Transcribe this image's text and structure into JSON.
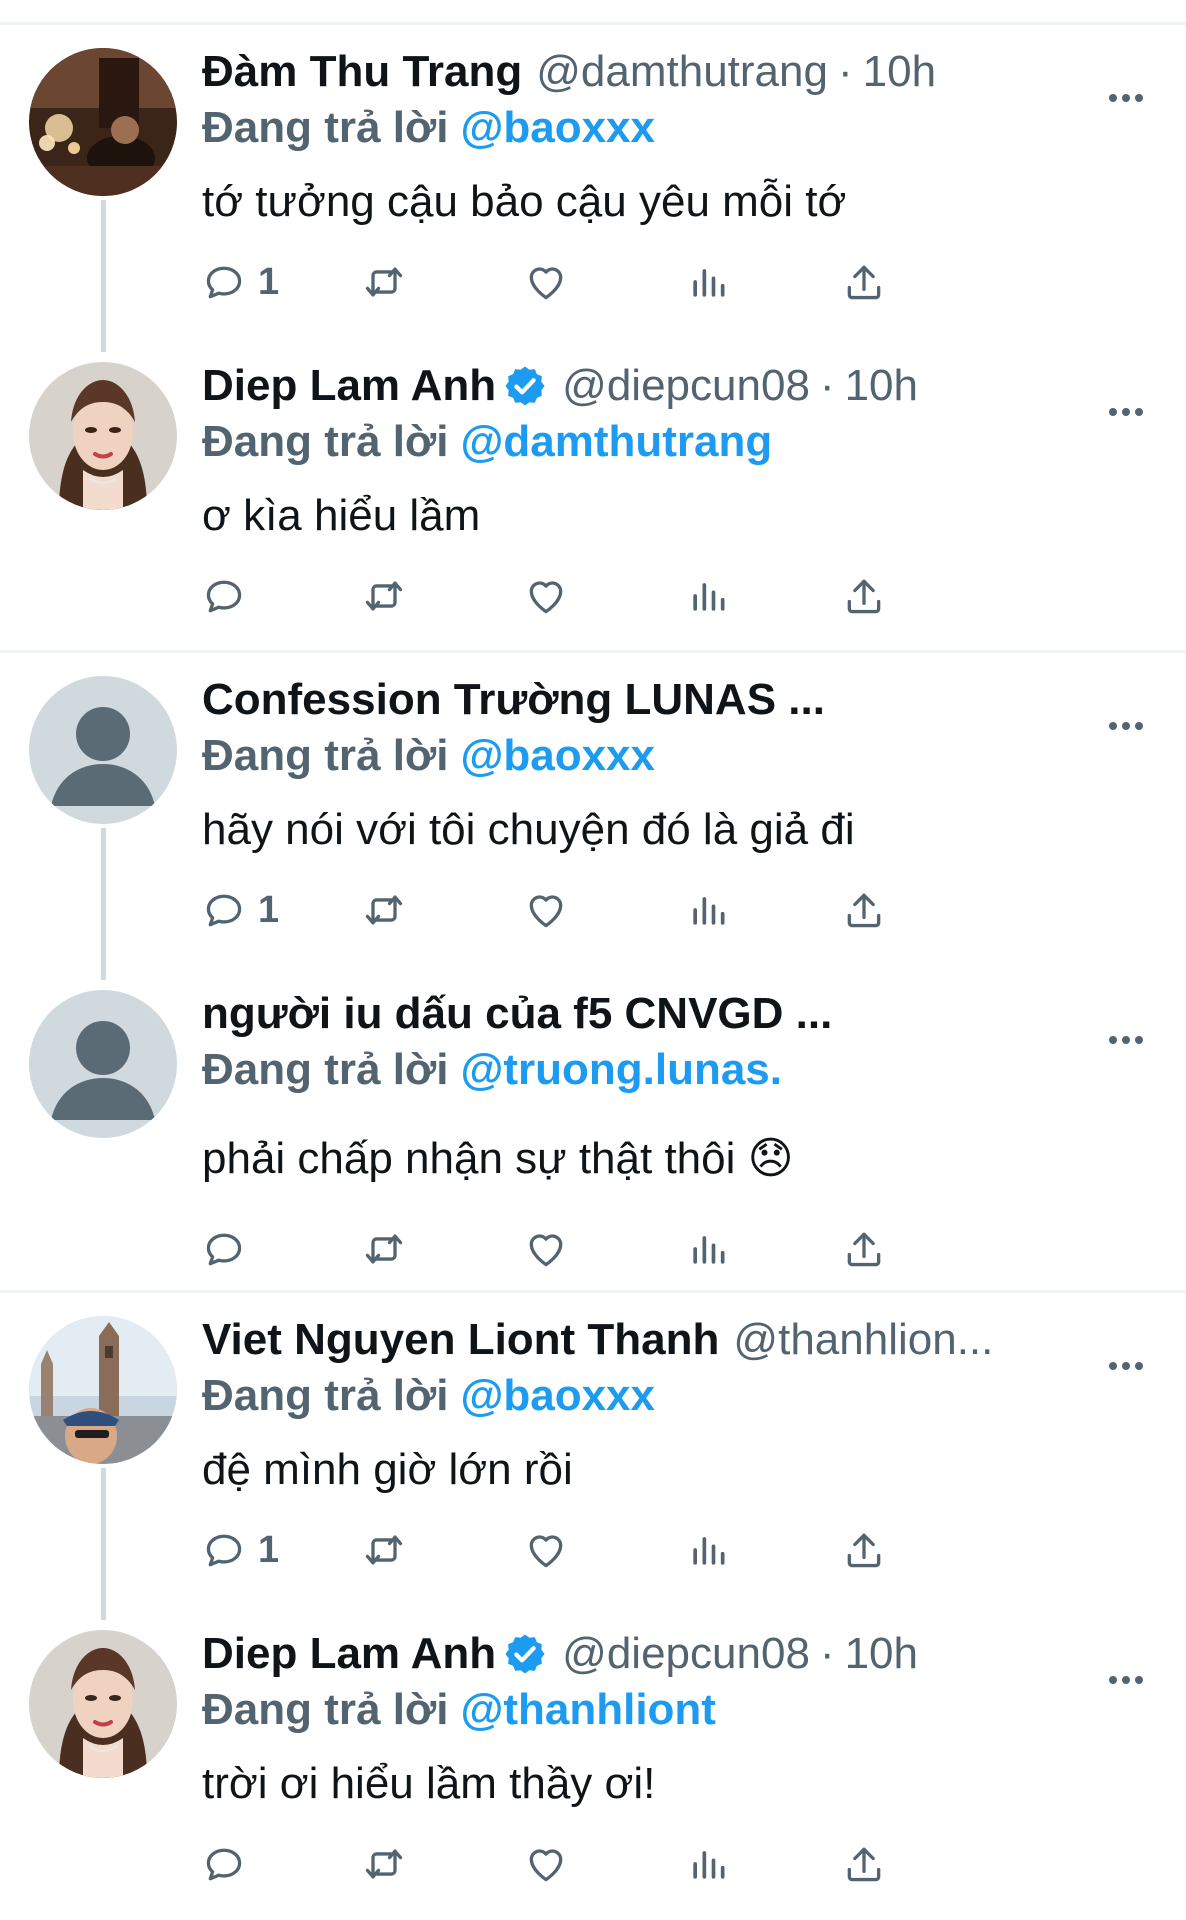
{
  "reply_prefix": "Đang trả lời",
  "tweets": [
    {
      "name": "Đàm Thu Trang",
      "verified": false,
      "handle": "@damthutrang",
      "separator": "·",
      "time": "10h",
      "reply_to": "@baoxxx",
      "text": "tớ tưởng cậu bảo cậu yêu mỗi tớ",
      "reply_count": "1",
      "avatar": "photo-candlelit-room"
    },
    {
      "name": "Diep Lam Anh",
      "verified": true,
      "handle": "@diepcun08",
      "separator": "·",
      "time": "10h",
      "reply_to": "@damthutrang",
      "text": "ơ kìa hiểu lầm",
      "reply_count": "",
      "avatar": "photo-woman-portrait"
    },
    {
      "name": "Confession Trường LUNAS ...",
      "verified": false,
      "handle": "",
      "separator": "",
      "time": "",
      "reply_to": "@baoxxx",
      "text": "hãy nói với tôi chuyện đó là giả đi",
      "reply_count": "1",
      "avatar": "default-profile"
    },
    {
      "name": "người iu dấu của f5 CNVGD ...",
      "verified": false,
      "handle": "",
      "separator": "",
      "time": "",
      "reply_to": "@truong.lunas.",
      "text": "phải chấp nhận sự thật thôi 😞",
      "reply_count": "",
      "avatar": "default-profile"
    },
    {
      "name": "Viet Nguyen Liont Thanh",
      "verified": false,
      "handle": "@thanhlion...",
      "separator": "",
      "time": "",
      "reply_to": "@baoxxx",
      "text": "đệ mình giờ lớn rồi",
      "reply_count": "1",
      "avatar": "photo-man-with-cap"
    },
    {
      "name": "Diep Lam Anh",
      "verified": true,
      "handle": "@diepcun08",
      "separator": "·",
      "time": "10h",
      "reply_to": "@thanhliont",
      "text": "trời ơi hiểu lầm thầy ơi!",
      "reply_count": "",
      "avatar": "photo-woman-portrait"
    }
  ],
  "icons": {
    "reply": "reply-icon",
    "retweet": "retweet-icon",
    "like": "heart-icon",
    "views": "views-icon",
    "share": "share-icon",
    "more": "more-icon",
    "verified": "verified-badge-icon"
  },
  "colors": {
    "link": "#1d9bf0",
    "secondary_text": "#536471",
    "primary_text": "#0f1419",
    "thread_line": "#cfd9de"
  }
}
